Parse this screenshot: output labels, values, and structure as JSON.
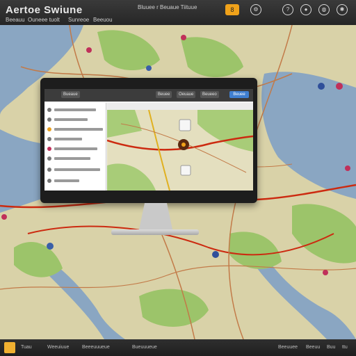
{
  "app": {
    "title": "Aertoe Swiune"
  },
  "toolbar": {
    "links": [
      "Beeauu",
      "Ouneee tuolt",
      "Sunreoe",
      "Beeuou"
    ],
    "center_text": "Bluuee r Beuaue Tiituue",
    "notification_count": "8",
    "icons": [
      "gear-icon",
      "help-icon",
      "user-icon",
      "globe-icon",
      "settings-icon"
    ]
  },
  "screen": {
    "tabs": [
      "Bueaue",
      "Beuee",
      "Oeuaue",
      "Beueeo"
    ],
    "action_button": "Beuee",
    "list_count": 8
  },
  "bottombar": {
    "items": [
      "Tuau",
      "Weeuiuue",
      "Beeeuuueue",
      "Bueuuueue",
      "Beeuuee",
      "Beeuu",
      "Buu",
      "ttu"
    ]
  },
  "colors": {
    "water": "#8aa6c2",
    "land": "#d9d2a8",
    "park": "#9cc46a",
    "route": "#cc2a10",
    "road": "#c27a48",
    "accent": "#f0a21a"
  }
}
